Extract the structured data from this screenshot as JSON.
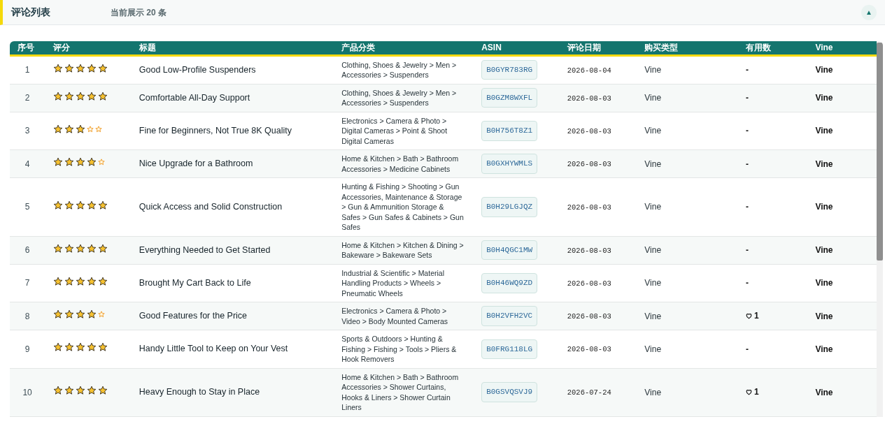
{
  "header": {
    "title": "评论列表",
    "count_text": "当前展示 20 条",
    "collapse_button": "▲"
  },
  "table": {
    "columns": [
      "序号",
      "评分",
      "标题",
      "产品分类",
      "ASIN",
      "评论日期",
      "购买类型",
      "有用数",
      "Vine"
    ],
    "rows": [
      {
        "index": "1",
        "stars": 5,
        "title": "Good Low-Profile Suspenders",
        "category": "Clothing, Shoes & Jewelry > Men > Accessories > Suspenders",
        "asin": "B0GYR783RG",
        "date": "2026-08-04",
        "purchase_type": "Vine",
        "helpful": {
          "text": "-",
          "heart": false
        },
        "vine": "Vine"
      },
      {
        "index": "2",
        "stars": 5,
        "title": "Comfortable All-Day Support",
        "category": "Clothing, Shoes & Jewelry > Men > Accessories > Suspenders",
        "asin": "B0GZM8WXFL",
        "date": "2026-08-03",
        "purchase_type": "Vine",
        "helpful": {
          "text": "-",
          "heart": false
        },
        "vine": "Vine"
      },
      {
        "index": "3",
        "stars": 3,
        "title": "Fine for Beginners, Not True 8K Quality",
        "category": "Electronics > Camera & Photo > Digital Cameras > Point & Shoot Digital Cameras",
        "asin": "B0H756T8Z1",
        "date": "2026-08-03",
        "purchase_type": "Vine",
        "helpful": {
          "text": "-",
          "heart": false
        },
        "vine": "Vine"
      },
      {
        "index": "4",
        "stars": 4,
        "title": "Nice Upgrade for a Bathroom",
        "category": "Home & Kitchen > Bath > Bathroom Accessories > Medicine Cabinets",
        "asin": "B0GXHYWMLS",
        "date": "2026-08-03",
        "purchase_type": "Vine",
        "helpful": {
          "text": "-",
          "heart": false
        },
        "vine": "Vine"
      },
      {
        "index": "5",
        "stars": 5,
        "title": "Quick Access and Solid Construction",
        "category": "Hunting & Fishing > Shooting > Gun Accessories, Maintenance & Storage > Gun & Ammunition Storage & Safes > Gun Safes & Cabinets > Gun Safes",
        "asin": "B0H29LGJQZ",
        "date": "2026-08-03",
        "purchase_type": "Vine",
        "helpful": {
          "text": "-",
          "heart": false
        },
        "vine": "Vine"
      },
      {
        "index": "6",
        "stars": 5,
        "title": "Everything Needed to Get Started",
        "category": "Home & Kitchen > Kitchen & Dining > Bakeware > Bakeware Sets",
        "asin": "B0H4QGC1MW",
        "date": "2026-08-03",
        "purchase_type": "Vine",
        "helpful": {
          "text": "-",
          "heart": false
        },
        "vine": "Vine"
      },
      {
        "index": "7",
        "stars": 5,
        "title": "Brought My Cart Back to Life",
        "category": "Industrial & Scientific > Material Handling Products > Wheels > Pneumatic Wheels",
        "asin": "B0H46WQ9ZD",
        "date": "2026-08-03",
        "purchase_type": "Vine",
        "helpful": {
          "text": "-",
          "heart": false
        },
        "vine": "Vine"
      },
      {
        "index": "8",
        "stars": 4,
        "title": "Good Features for the Price",
        "category": "Electronics > Camera & Photo > Video > Body Mounted Cameras",
        "asin": "B0H2VFH2VC",
        "date": "2026-08-03",
        "purchase_type": "Vine",
        "helpful": {
          "text": "1",
          "heart": true
        },
        "vine": "Vine"
      },
      {
        "index": "9",
        "stars": 5,
        "title": "Handy Little Tool to Keep on Your Vest",
        "category": "Sports & Outdoors > Hunting & Fishing > Fishing > Tools > Pliers & Hook Removers",
        "asin": "B0FRG118LG",
        "date": "2026-08-03",
        "purchase_type": "Vine",
        "helpful": {
          "text": "-",
          "heart": false
        },
        "vine": "Vine"
      },
      {
        "index": "10",
        "stars": 5,
        "title": "Heavy Enough to Stay in Place",
        "category": "Home & Kitchen > Bath > Bathroom Accessories > Shower Curtains, Hooks & Liners > Shower Curtain Liners",
        "asin": "B0GSVQSVJ9",
        "date": "2026-07-24",
        "purchase_type": "Vine",
        "helpful": {
          "text": "1",
          "heart": true
        },
        "vine": "Vine"
      }
    ]
  }
}
